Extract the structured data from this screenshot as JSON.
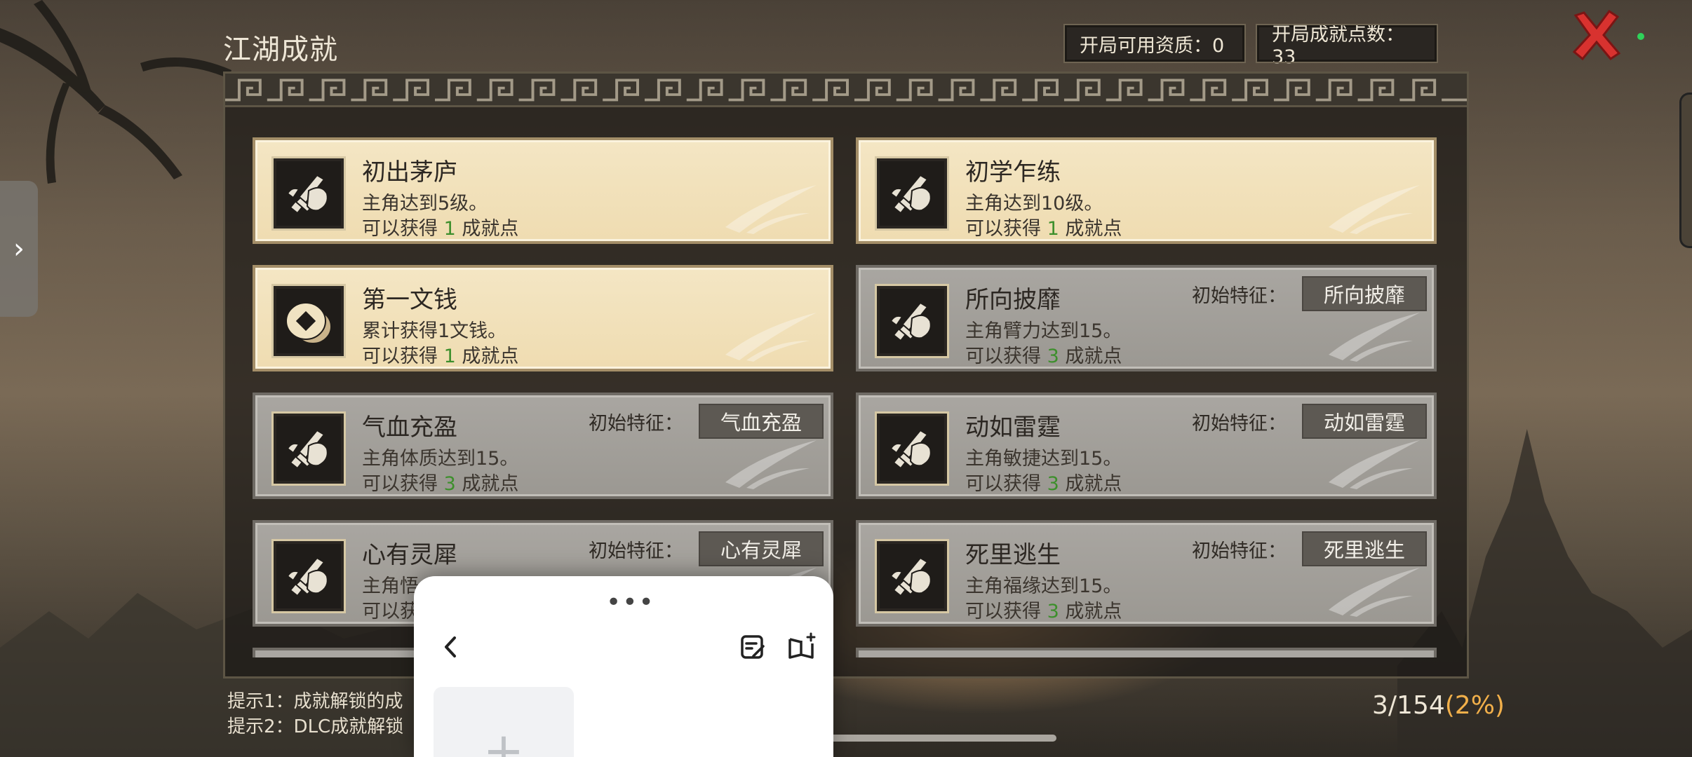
{
  "header": {
    "title": "江湖成就",
    "available_resources": "开局可用资质：0",
    "start_points": "开局成就点数：33"
  },
  "achievements": [
    {
      "name": "初出茅庐",
      "desc": "主角达到5级。",
      "reward_prefix": "可以获得",
      "reward_num": "1",
      "reward_suffix": "成就点",
      "state": "unlocked",
      "icon": "sword-fist-icon"
    },
    {
      "name": "初学乍练",
      "desc": "主角达到10级。",
      "reward_prefix": "可以获得",
      "reward_num": "1",
      "reward_suffix": "成就点",
      "state": "unlocked",
      "icon": "sword-fist-icon"
    },
    {
      "name": "第一文钱",
      "desc": "累计获得1文钱。",
      "reward_prefix": "可以获得",
      "reward_num": "1",
      "reward_suffix": "成就点",
      "state": "unlocked",
      "icon": "coin-icon"
    },
    {
      "name": "所向披靡",
      "desc": "主角臂力达到15。",
      "reward_prefix": "可以获得",
      "reward_num": "3",
      "reward_suffix": "成就点",
      "state": "locked",
      "trait_label": "初始特征：",
      "trait": "所向披靡",
      "icon": "sword-fist-icon"
    },
    {
      "name": "气血充盈",
      "desc": "主角体质达到15。",
      "reward_prefix": "可以获得",
      "reward_num": "3",
      "reward_suffix": "成就点",
      "state": "locked",
      "trait_label": "初始特征：",
      "trait": "气血充盈",
      "icon": "sword-fist-icon"
    },
    {
      "name": "动如雷霆",
      "desc": "主角敏捷达到15。",
      "reward_prefix": "可以获得",
      "reward_num": "3",
      "reward_suffix": "成就点",
      "state": "locked",
      "trait_label": "初始特征：",
      "trait": "动如雷霆",
      "icon": "sword-fist-icon"
    },
    {
      "name": "心有灵犀",
      "desc": "主角悟",
      "reward_prefix": "可以获",
      "reward_num": "",
      "reward_suffix": "",
      "state": "locked",
      "trait_label": "初始特征：",
      "trait": "心有灵犀",
      "icon": "sword-fist-icon"
    },
    {
      "name": "死里逃生",
      "desc": "主角福缘达到15。",
      "reward_prefix": "可以获得",
      "reward_num": "3",
      "reward_suffix": "成就点",
      "state": "locked",
      "trait_label": "初始特征：",
      "trait": "死里逃生",
      "icon": "sword-fist-icon"
    }
  ],
  "hints": {
    "hint1": "提示1：成就解锁的成",
    "hint2": "提示2：DLC成就解锁"
  },
  "progress": {
    "count": "3/154",
    "percent": "(2%)"
  },
  "sheet": {
    "dots": "•••",
    "add": "+"
  },
  "side_handle": "›",
  "colors": {
    "unlocked_card": "#f4e6c4",
    "locked_card": "#a9a6a1",
    "reward_green": "#3d8f2c",
    "percent_orange": "#f2b04a",
    "close_red": "#d8322f"
  }
}
